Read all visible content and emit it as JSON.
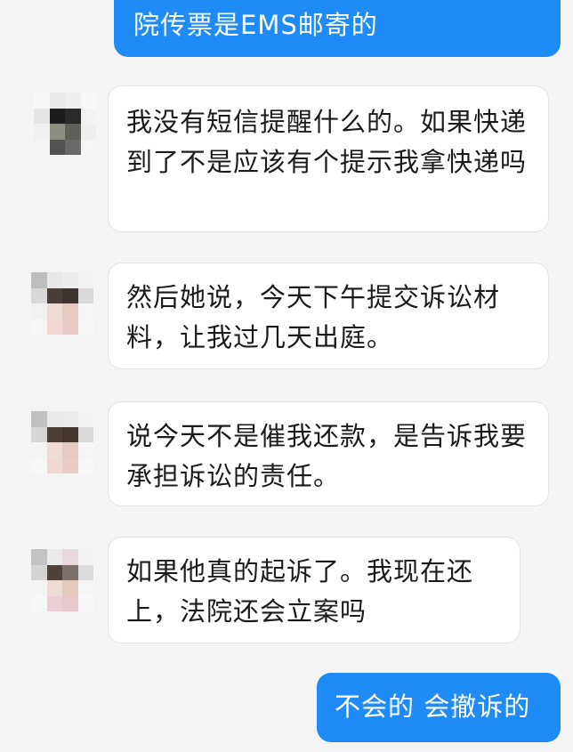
{
  "colors": {
    "background": "#f4f4f4",
    "outgoing_bubble": "#1e8bf6",
    "incoming_bubble": "#ffffff",
    "text_dark": "#1b1b1b"
  },
  "messages": [
    {
      "sender": "self",
      "text": "院传票是EMS邮寄的"
    },
    {
      "sender": "other",
      "text": "我没有短信提醒什么的。如果快递到了不是应该有个提示我拿快递吗"
    },
    {
      "sender": "other",
      "text": "然后她说，今天下午提交诉讼材料，让我过几天出庭。"
    },
    {
      "sender": "other",
      "text": "说今天不是催我还款，是告诉我要承担诉讼的责任。"
    },
    {
      "sender": "other",
      "text": "如果他真的起诉了。我现在还上，法院还会立案吗"
    },
    {
      "sender": "self",
      "text": "不会的 会撤诉的"
    }
  ],
  "avatars": {
    "description_icon": "pixelated-avatar-icon"
  }
}
